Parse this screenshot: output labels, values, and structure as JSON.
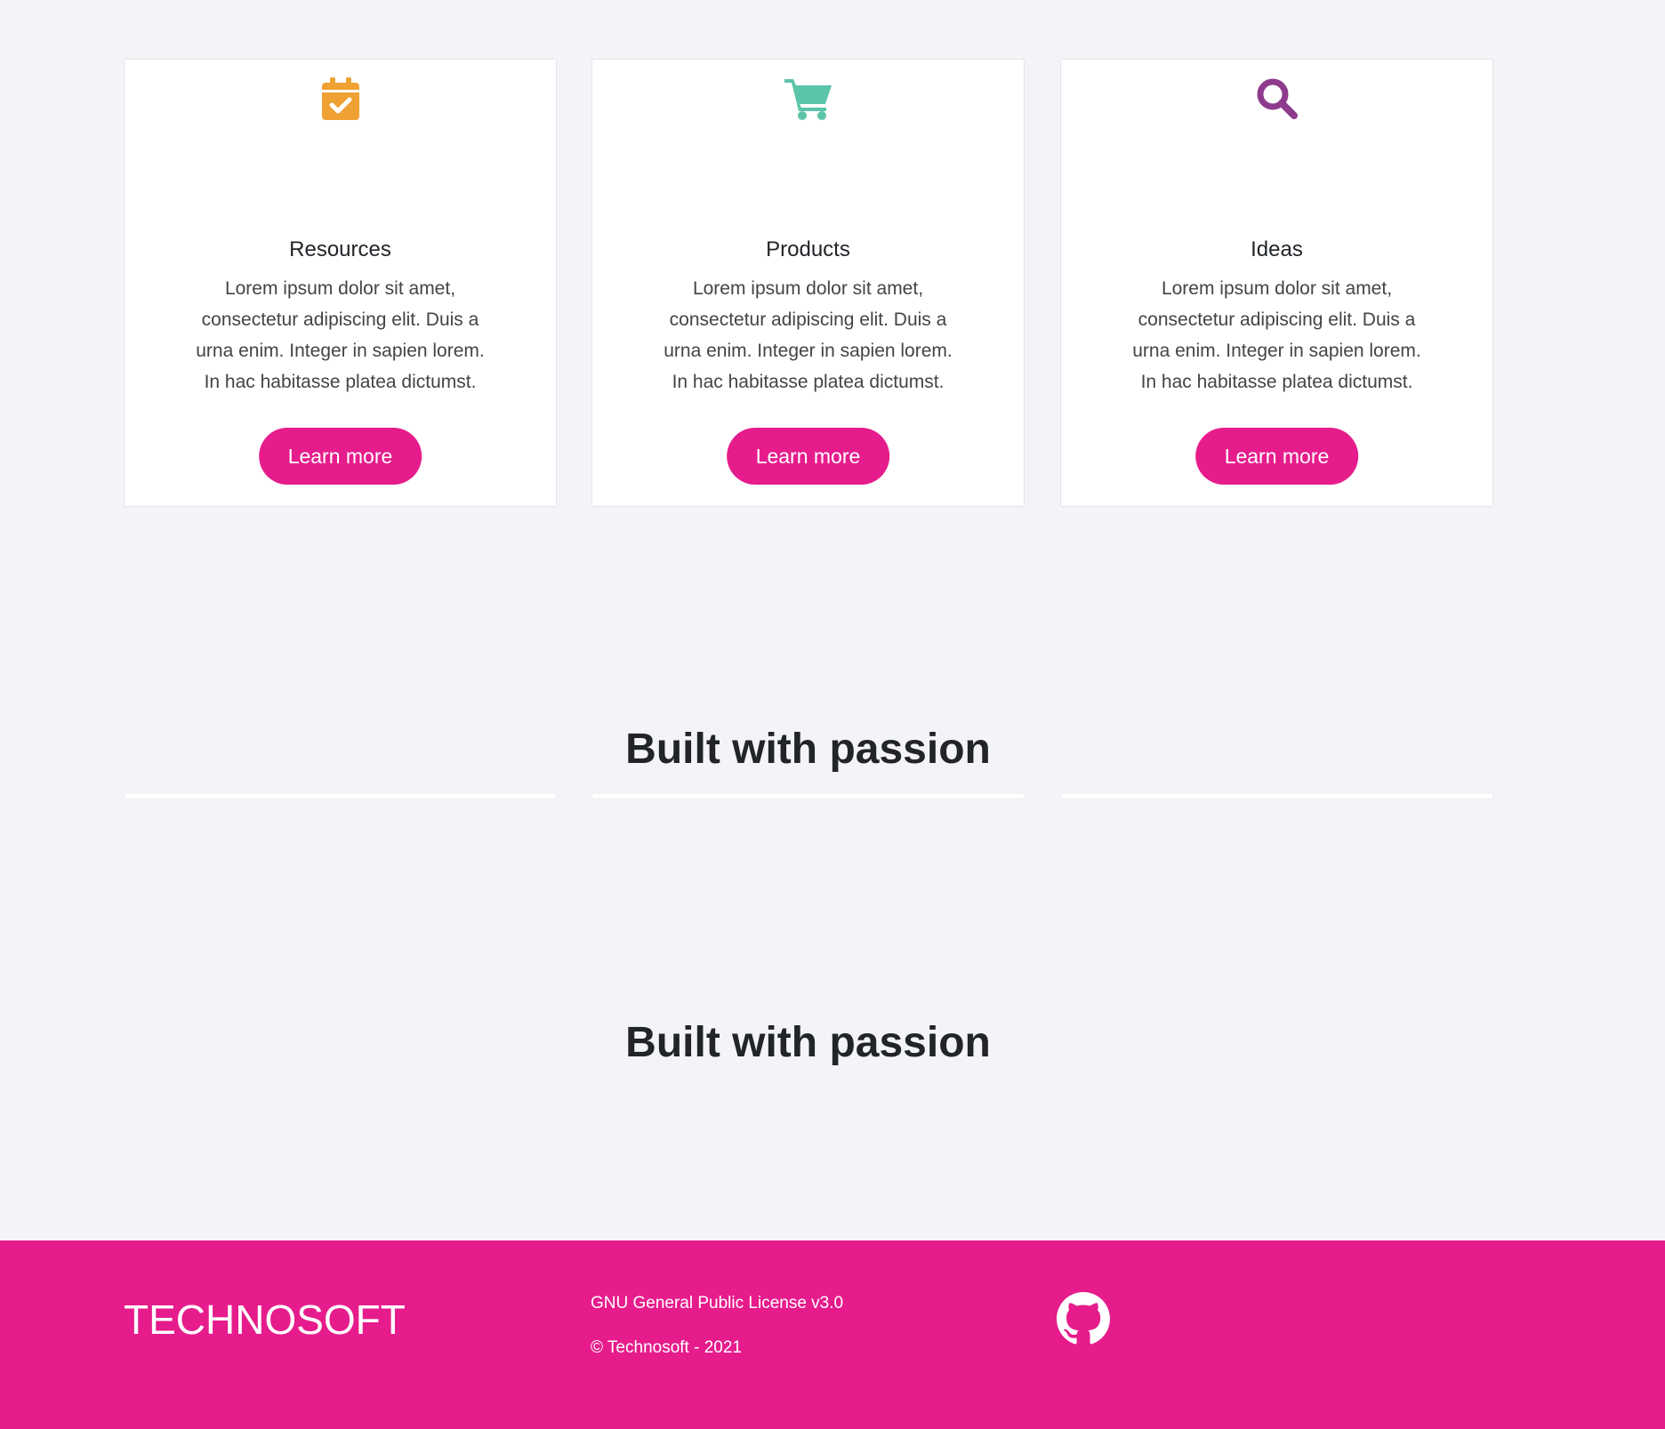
{
  "cards": [
    {
      "icon": "calendar-check-icon",
      "icon_color": "#f0a133",
      "title": "Resources",
      "body": "Lorem ipsum dolor sit amet, consectetur adipiscing elit. Duis a urna enim. Integer in sapien lorem. In hac habitasse platea dictumst.",
      "button_label": "Learn more"
    },
    {
      "icon": "shopping-cart-icon",
      "icon_color": "#5cc4a8",
      "title": "Products",
      "body": "Lorem ipsum dolor sit amet, consectetur adipiscing elit. Duis a urna enim. Integer in sapien lorem. In hac habitasse platea dictumst.",
      "button_label": "Learn more"
    },
    {
      "icon": "search-icon",
      "icon_color": "#8e3b8e",
      "title": "Ideas",
      "body": "Lorem ipsum dolor sit amet, consectetur adipiscing elit. Duis a urna enim. Integer in sapien lorem. In hac habitasse platea dictumst.",
      "button_label": "Learn more"
    }
  ],
  "sections": [
    {
      "heading": "Built with passion"
    },
    {
      "heading": "Built with passion"
    }
  ],
  "footer": {
    "brand": "TECHNOSOFT",
    "license": "GNU General Public License v3.0",
    "copyright": "© Technosoft - 2021",
    "icon": "github-icon"
  },
  "colors": {
    "accent": "#e61c8c",
    "background": "#f4f4f8"
  }
}
